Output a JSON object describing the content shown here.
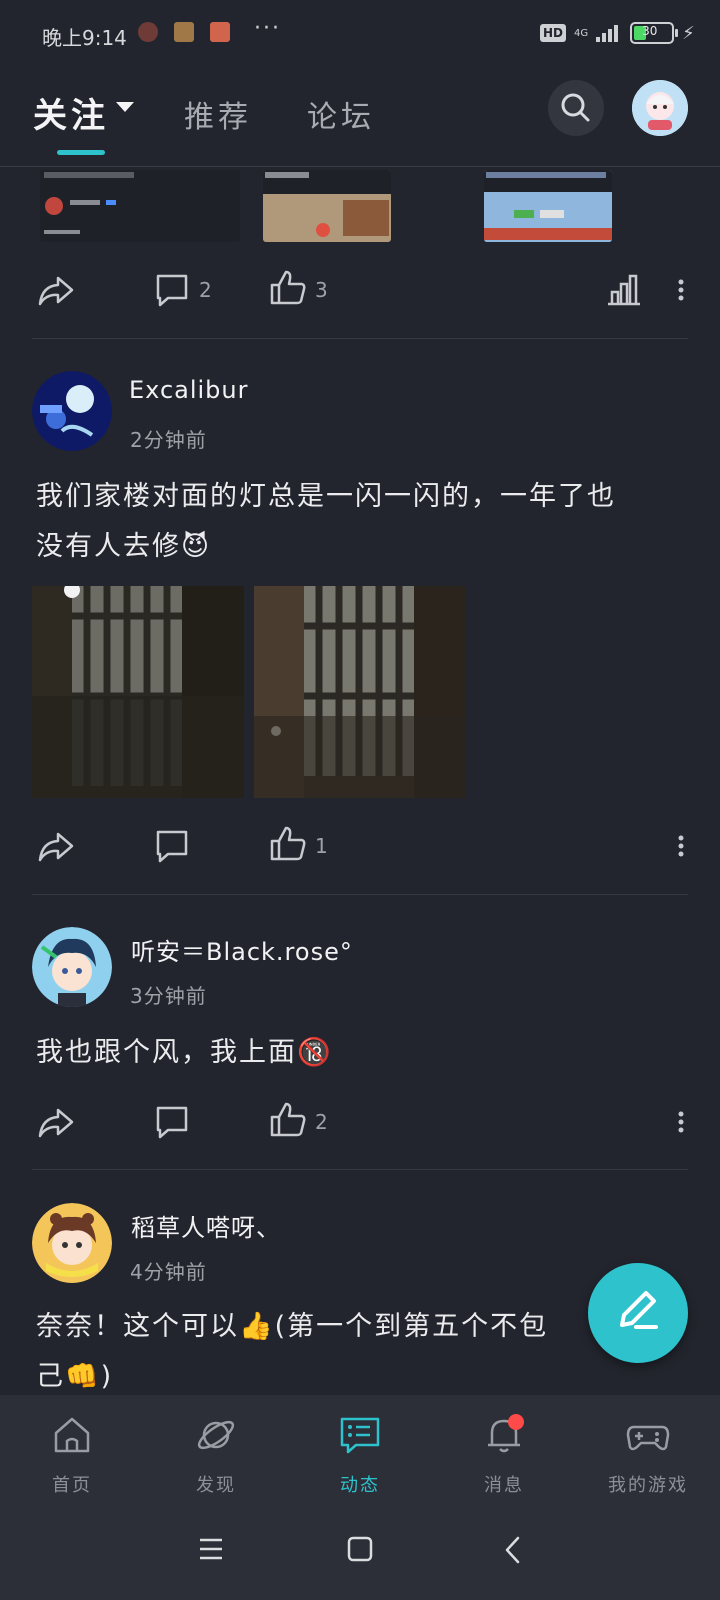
{
  "status_bar": {
    "time": "晚上9:14",
    "dots": "···",
    "hd": "HD",
    "network": "4G",
    "battery": "30"
  },
  "header": {
    "tabs": [
      {
        "label": "关注",
        "active": true
      },
      {
        "label": "推荐",
        "active": false
      },
      {
        "label": "论坛",
        "active": false
      }
    ],
    "accent_color": "#2ec2cc"
  },
  "posts": [
    {
      "id": "post-0",
      "comments": "2",
      "likes": "3"
    },
    {
      "id": "post-1",
      "author": "Excalibur",
      "time": "2分钟前",
      "text_line1": "我们家楼对面的灯总是一闪一闪的，一年了也",
      "text_line2": "没有人去修",
      "emoji": "😈",
      "likes": "1"
    },
    {
      "id": "post-2",
      "author": "听安＝Black.rose°",
      "time": "3分钟前",
      "text": "我也跟个风，我上面",
      "emoji": "🔞",
      "likes": "2"
    },
    {
      "id": "post-3",
      "author": "稻草人嗒呀、",
      "time": "4分钟前",
      "text_line1": "奈奈！这个可以",
      "emoji1": "👍",
      "text_line1b": "(第一个到第五个不包",
      "text_line2": "己",
      "emoji2": "👊",
      "text_line2b": ")"
    }
  ],
  "bottom_nav": [
    {
      "label": "首页",
      "icon": "home-icon"
    },
    {
      "label": "发现",
      "icon": "planet-icon"
    },
    {
      "label": "动态",
      "icon": "feed-icon",
      "active": true
    },
    {
      "label": "消息",
      "icon": "bell-icon",
      "badge": true
    },
    {
      "label": "我的游戏",
      "icon": "gamepad-icon"
    }
  ]
}
